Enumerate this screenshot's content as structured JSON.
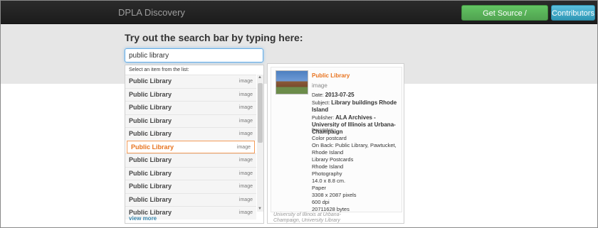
{
  "navbar": {
    "brand": "DPLA Discovery",
    "source_button": "Get Source / Documentation",
    "contributors_button": "Contributors"
  },
  "main": {
    "heading": "Try out the search bar by typing here:",
    "search": {
      "value": "public library"
    }
  },
  "dropdown": {
    "hint": "Select an item from the list:",
    "items": [
      {
        "title": "Public Library",
        "type": "image"
      },
      {
        "title": "Public Library",
        "type": "image"
      },
      {
        "title": "Public Library",
        "type": "image"
      },
      {
        "title": "Public Library",
        "type": "image"
      },
      {
        "title": "Public Library",
        "type": "image"
      },
      {
        "title": "Public Library",
        "type": "image"
      },
      {
        "title": "Public Library",
        "type": "image"
      },
      {
        "title": "Public Library",
        "type": "image"
      },
      {
        "title": "Public Library",
        "type": "image"
      },
      {
        "title": "Public Library",
        "type": "image"
      },
      {
        "title": "Public Library",
        "type": "image"
      }
    ],
    "active_index": 5,
    "view_more": "view more"
  },
  "preview": {
    "title": "Public Library",
    "type": "image",
    "date_label": "Date:",
    "date": "2013-07-25",
    "subject_label": "Subject:",
    "subject": "Library buildings Rhode Island",
    "publisher_label": "Publisher:",
    "publisher": "ALA Archives - University of Illinois at Urbana-Champaign",
    "description_label": "Description:",
    "description": [
      "Color postcard",
      "On Back: Public Library, Pawtucket,",
      "Rhode Island",
      "Library Postcards",
      "Rhode Island",
      "Photography",
      "14.0 x 8.8 cm.",
      "Paper",
      "3308 x 2087 pixels",
      "600 dpi",
      "20711628 bytes"
    ],
    "source_line1": "University of Illinois at Urbana-",
    "source_line2": "Champaign, University Library"
  },
  "colors": {
    "accent": "#e8731f",
    "source_button": "#51a351",
    "contributors_button": "#2f96b4",
    "navbar": "#222222"
  }
}
